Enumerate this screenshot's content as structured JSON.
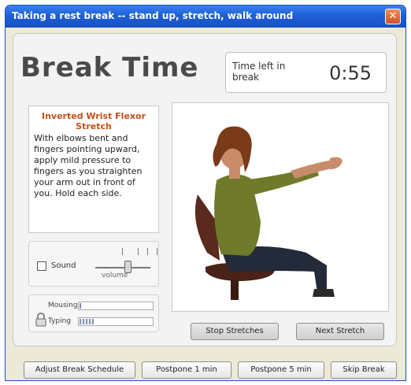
{
  "window": {
    "title": "Taking a rest break -- stand up, stretch, walk around",
    "close_glyph": "✕"
  },
  "header": {
    "title": "Break Time",
    "time_left_label": "Time left in break",
    "time_left_value": "0:55"
  },
  "stretch": {
    "title": "Inverted Wrist Flexor Stretch",
    "description": "With elbows bent and fingers pointing upward, apply mild pressure to fingers as you straighten your arm out in front of you. Hold each side."
  },
  "sound": {
    "checkbox_label": "Sound",
    "volume_label": "volume",
    "volume_level": 0.6
  },
  "activity": {
    "mousing_label": "Mousing",
    "mousing_level": 0.04,
    "typing_label": "Typing",
    "typing_level": 0.2
  },
  "image_buttons": {
    "stop_stretches": "Stop Stretches",
    "next_stretch": "Next Stretch"
  },
  "footer": {
    "adjust": "Adjust Break Schedule",
    "postpone_1": "Postpone 1 min",
    "postpone_5": "Postpone 5 min",
    "skip": "Skip Break"
  },
  "colors": {
    "titlebar": "#1d5fd6",
    "accent_title": "#c0501e",
    "close": "#d5502a"
  }
}
